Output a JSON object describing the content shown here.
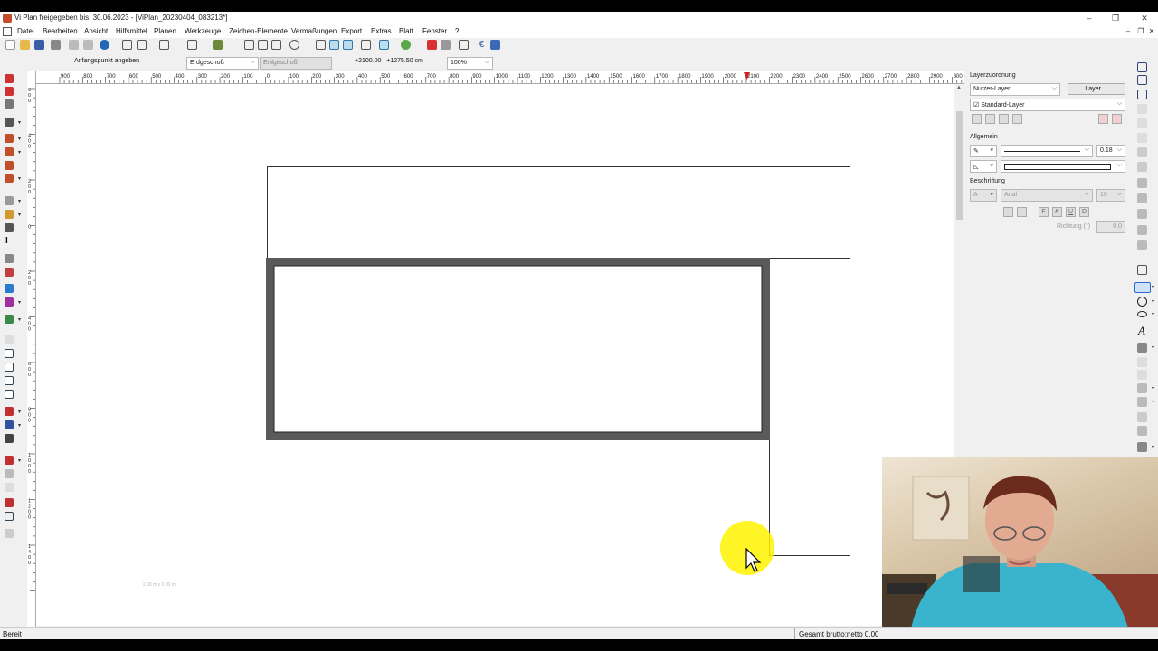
{
  "window": {
    "title": "Vi Plan freigegeben bis: 30.06.2023 - [ViPlan_20230404_083213*]"
  },
  "menu": [
    "Datei",
    "Bearbeiten",
    "Ansicht",
    "Hilfsmittel",
    "Planen",
    "Werkzeuge",
    "Zeichen-Elemente",
    "Vermaßungen",
    "Export",
    "Extras",
    "Blatt",
    "Fenster",
    "?"
  ],
  "toolbar2": {
    "prompt": "Anfangspunkt angeben",
    "floor_active": "Erdgeschoß",
    "floor_secondary": "Erdgeschoß",
    "coordinates": "+2100.00 : +1275.50 cm",
    "zoom": "100%"
  },
  "ruler": {
    "h_labels": [
      "900",
      "800",
      "700",
      "600",
      "500",
      "400",
      "300",
      "200",
      "100",
      "0",
      "100",
      "200",
      "300",
      "400",
      "500",
      "600",
      "700",
      "800",
      "900",
      "1000",
      "1100",
      "1200",
      "1300",
      "1400",
      "1500",
      "1600",
      "1700",
      "1800",
      "1900",
      "2000",
      "2100",
      "2200",
      "2300",
      "2400",
      "2500",
      "2600",
      "2700",
      "2800",
      "2900",
      "300"
    ],
    "v_labels": [
      "600",
      "400",
      "200",
      "0",
      "200",
      "400",
      "600",
      "800",
      "1000",
      "1200",
      "1400"
    ]
  },
  "canvas": {
    "hint": "2.00 m x 2.00 m"
  },
  "panel": {
    "layer_section": "Layerzuordnung",
    "layer_select": "Nutzer-Layer",
    "layer_button": "Layer ...",
    "standard_layer": "Standard-Layer",
    "general_section": "Allgemein",
    "line_width": "0.18",
    "label_section": "Beschriftung",
    "font": "Arial",
    "font_size": "10",
    "format_buttons": [
      "F",
      "K",
      "U",
      "D"
    ],
    "direction_label": "Richtung (°)",
    "direction_value": "0.0"
  },
  "status": {
    "left": "Bereit",
    "right": "Gesamt brutto:netto 0.00"
  }
}
